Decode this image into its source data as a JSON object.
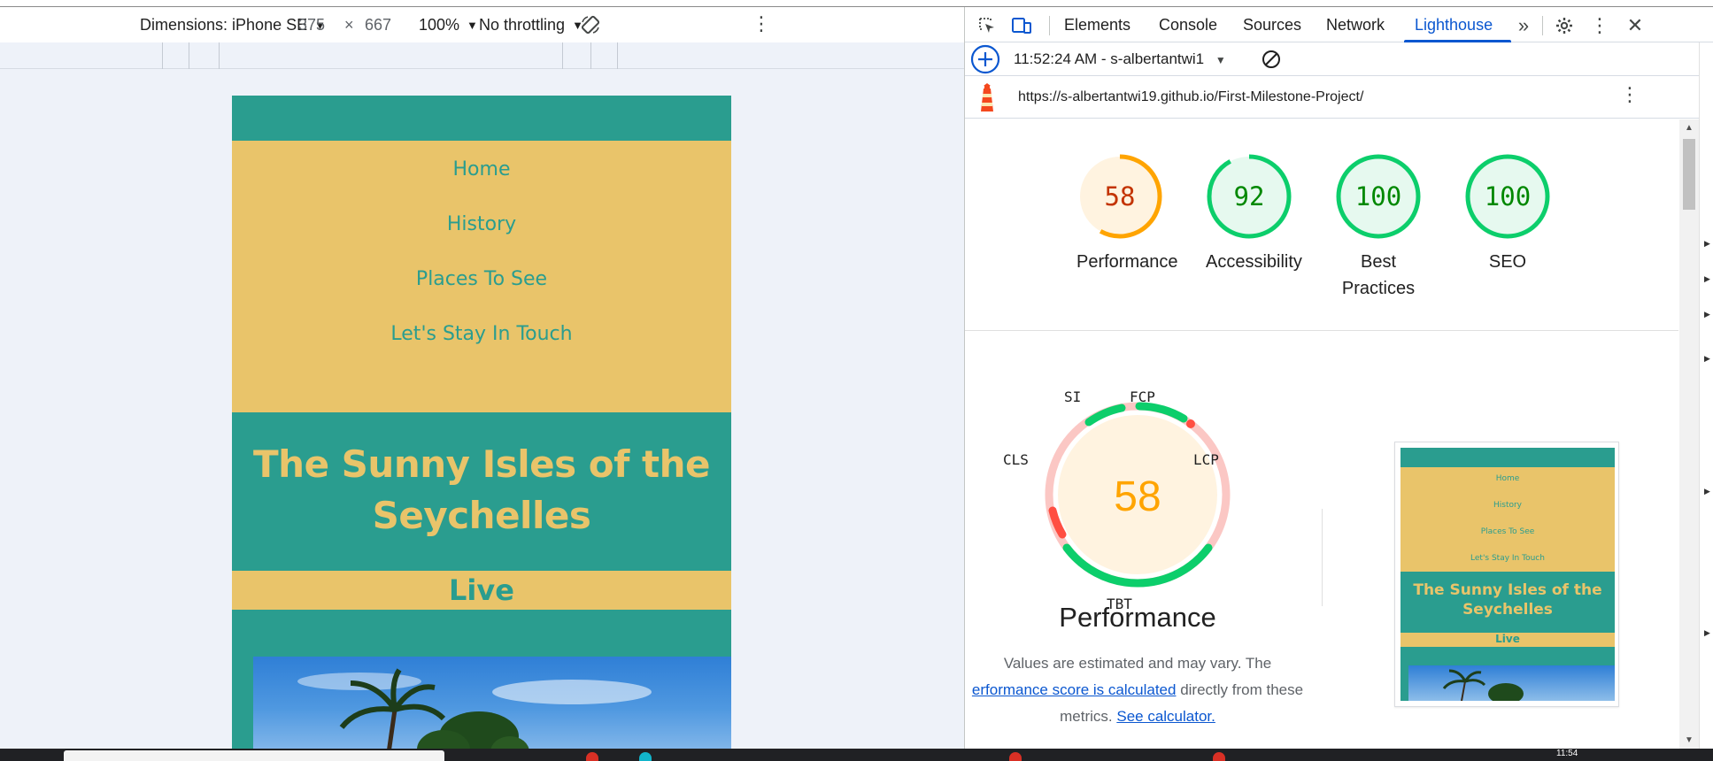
{
  "device_toolbar": {
    "dimensions_label": "Dimensions: iPhone SE",
    "width_value": "375",
    "times": "×",
    "height_value": "667",
    "zoom": "100%",
    "throttling": "No throttling"
  },
  "site": {
    "nav": [
      "Home",
      "History",
      "Places To See",
      "Let's Stay In Touch"
    ],
    "hero_title": "The Sunny Isles of the Seychelles",
    "live_label": "Live"
  },
  "devtools": {
    "tabs": [
      "Elements",
      "Console",
      "Sources",
      "Network",
      "Lighthouse"
    ],
    "active_tab": "Lighthouse",
    "run_label": "11:52:24 AM - s-albertantwi1",
    "url": "https://s-albertantwi19.github.io/First-Milestone-Project/"
  },
  "scores": [
    {
      "value": "58",
      "label": "Performance",
      "score": 0.58,
      "status": "average"
    },
    {
      "value": "92",
      "label": "Accessibility",
      "score": 0.92,
      "status": "pass"
    },
    {
      "value": "100",
      "label": "Best Practices",
      "score": 1.0,
      "status": "pass"
    },
    {
      "value": "100",
      "label": "SEO",
      "score": 1.0,
      "status": "pass"
    }
  ],
  "performance": {
    "score": "58",
    "title": "Performance",
    "metrics": [
      "SI",
      "FCP",
      "LCP",
      "TBT",
      "CLS"
    ],
    "desc_1": "Values are estimated and may vary. The",
    "link_1": "erformance score is calculated",
    "desc_2": "directly from these",
    "desc_3": "metrics.",
    "link_2": "See calculator."
  },
  "colors": {
    "site_teal": "#2a9d8f",
    "site_yellow": "#e9c46a",
    "score_average": "#ffa400",
    "score_pass": "#0cce6b",
    "score_fail": "#ff4e42",
    "devtools_accent": "#0b57d0"
  },
  "taskbar": {
    "time": "11:54"
  }
}
